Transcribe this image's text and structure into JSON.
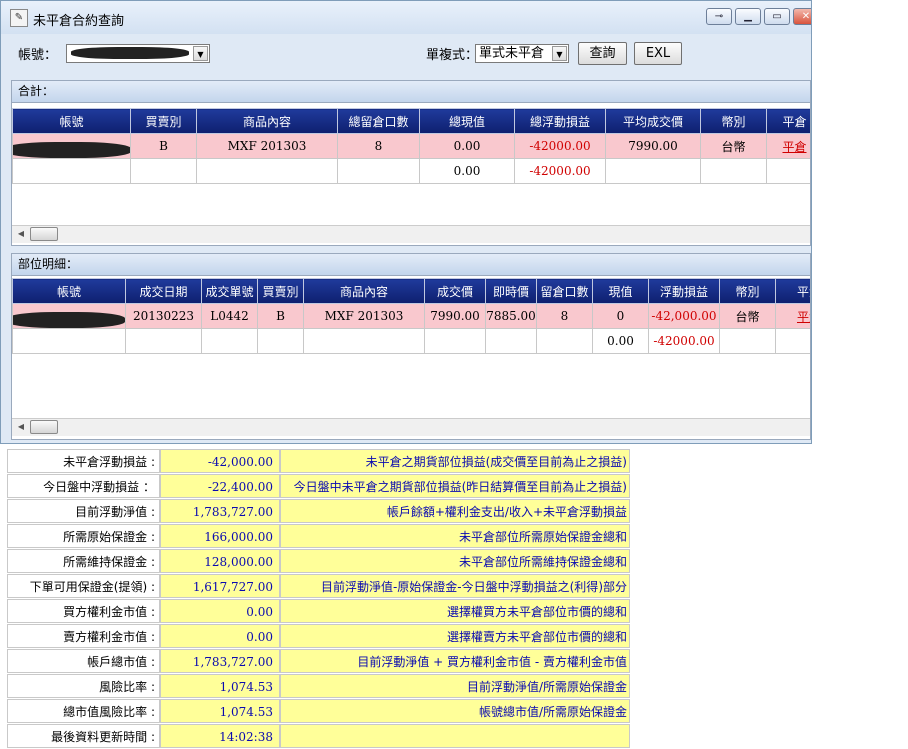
{
  "window": {
    "title": "未平倉合約查詢",
    "icon": "app-icon"
  },
  "toolbar": {
    "account_label": "帳號：",
    "mode_label": "單複式：",
    "mode_value": "單式未平倉",
    "query_label": "查詢",
    "exl_label": "EXL"
  },
  "total_panel": {
    "title": "合計：",
    "headers": [
      "帳號",
      "買賣別",
      "商品內容",
      "總留倉口數",
      "總現值",
      "總浮動損益",
      "平均成交價",
      "幣別",
      "平倉"
    ],
    "rows": [
      [
        "",
        "B",
        "MXF 201303",
        "8",
        "0.00",
        "-42000.00",
        "7990.00",
        "台幣",
        "平倉"
      ],
      [
        "",
        "",
        "",
        "",
        "0.00",
        "-42000.00",
        "",
        "",
        ""
      ]
    ]
  },
  "detail_panel": {
    "title": "部位明細：",
    "headers": [
      "帳號",
      "成交日期",
      "成交單號",
      "買賣別",
      "商品內容",
      "成交價",
      "即時價",
      "留倉口數",
      "現值",
      "浮動損益",
      "幣別",
      "平倉"
    ],
    "rows": [
      [
        "",
        "20130223",
        "L0442",
        "B",
        "MXF 201303",
        "7990.00",
        "7885.00",
        "8",
        "0",
        "-42,000.00",
        "台幣",
        "平倉"
      ],
      [
        "",
        "",
        "",
        "",
        "",
        "",
        "",
        "",
        "0.00",
        "-42000.00",
        "",
        ""
      ]
    ]
  },
  "summary": [
    {
      "label": "未平倉浮動損益 :",
      "value": "-42,000.00",
      "desc": "未平倉之期貨部位損益(成交價至目前為止之損益)"
    },
    {
      "label": "今日盤中浮動損益 ：",
      "value": "-22,400.00",
      "desc": "今日盤中未平倉之期貨部位損益(昨日結算價至目前為止之損益)"
    },
    {
      "label": "目前浮動淨值 :",
      "value": "1,783,727.00",
      "desc": "帳戶餘額+權利金支出/收入+未平倉浮動損益"
    },
    {
      "label": "所需原始保證金 :",
      "value": "166,000.00",
      "desc": "未平倉部位所需原始保證金總和"
    },
    {
      "label": "所需維持保證金 :",
      "value": "128,000.00",
      "desc": "未平倉部位所需維持保證金總和"
    },
    {
      "label": "下單可用保證金(提領) :",
      "value": "1,617,727.00",
      "desc": "目前浮動淨值-原始保證金-今日盤中浮動損益之(利得)部分"
    },
    {
      "label": "買方權利金市值 :",
      "value": "0.00",
      "desc": "選擇權買方未平倉部位市價的總和"
    },
    {
      "label": "賣方權利金市值 :",
      "value": "0.00",
      "desc": "選擇權賣方未平倉部位市價的總和"
    },
    {
      "label": "帳戶總市值 :",
      "value": "1,783,727.00",
      "desc": "目前浮動淨值 + 買方權利金市值 - 賣方權利金市值"
    },
    {
      "label": "風險比率 :",
      "value": "1,074.53",
      "desc": "目前浮動淨值/所需原始保證金"
    },
    {
      "label": "總市值風險比率 :",
      "value": "1,074.53",
      "desc": "帳號總市值/所需原始保證金"
    },
    {
      "label": "最後資料更新時間 :",
      "value": "14:02:38",
      "desc": ""
    }
  ],
  "colors": {
    "header_bg": "#0e1f6e",
    "pink_row": "#f9c8ce",
    "negative": "#d00000",
    "summary_bg": "#ffff99",
    "summary_text": "#0a0ab0"
  }
}
